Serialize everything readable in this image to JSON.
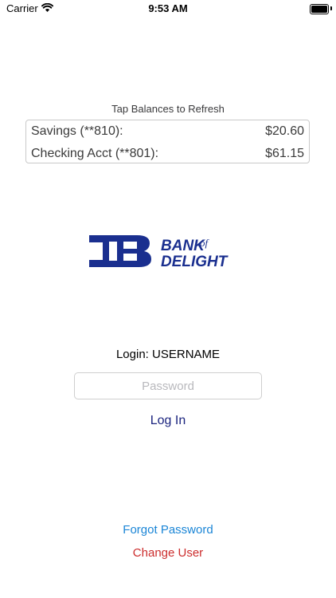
{
  "status_bar": {
    "carrier": "Carrier",
    "time": "9:53 AM",
    "icons": [
      "wifi-icon",
      "battery-icon"
    ]
  },
  "balances": {
    "hint": "Tap Balances to Refresh",
    "accounts": [
      {
        "name": "Savings (**810):",
        "amount": "$20.60"
      },
      {
        "name": "Checking Acct (**801):",
        "amount": "$61.15"
      }
    ]
  },
  "logo": {
    "word1": "BANK",
    "word_of": "of",
    "word2": "DELIGHT",
    "color": "#1a2f8f"
  },
  "login": {
    "label": "Login:",
    "username": "USERNAME",
    "password_placeholder": "Password",
    "login_button": "Log In",
    "forgot_password": "Forgot Password",
    "change_user": "Change User"
  },
  "colors": {
    "login_button": "#1a237e",
    "forgot_password": "#1a85d6",
    "change_user": "#cc2d2d"
  }
}
